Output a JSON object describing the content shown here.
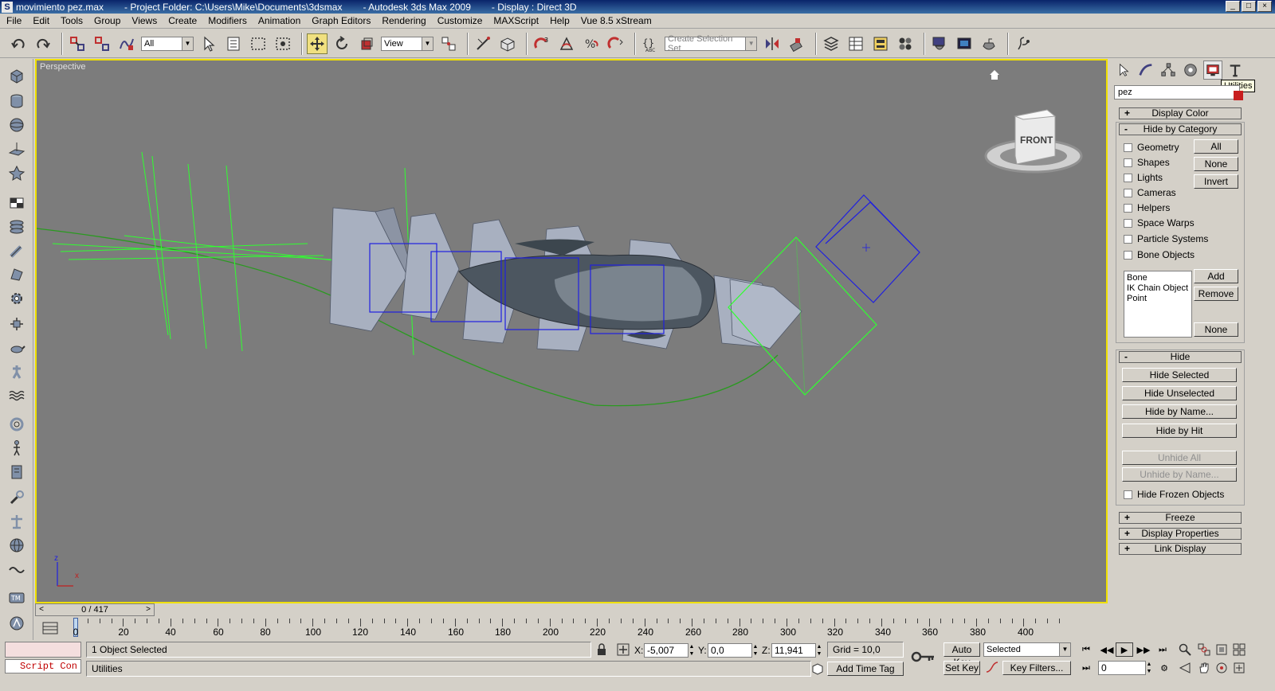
{
  "titlebar": {
    "file": "movimiento pez.max",
    "project": "- Project Folder: C:\\Users\\Mike\\Documents\\3dsmax",
    "app": "- Autodesk 3ds Max  2009",
    "display": "- Display : Direct 3D"
  },
  "menu": [
    "File",
    "Edit",
    "Tools",
    "Group",
    "Views",
    "Create",
    "Modifiers",
    "Animation",
    "Graph Editors",
    "Rendering",
    "Customize",
    "MAXScript",
    "Help",
    "Vue 8.5 xStream"
  ],
  "toolbar": {
    "selection_filter": "All",
    "ref_coord": "View",
    "selection_set_placeholder": "Create Selection Set"
  },
  "viewport": {
    "label": "Perspective",
    "viewcube_label": "FRONT",
    "axis_x": "x",
    "axis_z": "z"
  },
  "panel": {
    "tooltip": "Utilities",
    "name_field": "pez",
    "name_color": "#c81e1e",
    "rollouts": {
      "display_color": "Display Color",
      "hide_by_category": "Hide by Category",
      "hide": "Hide",
      "freeze": "Freeze",
      "display_properties": "Display Properties",
      "link_display": "Link Display"
    },
    "categories": [
      "Geometry",
      "Shapes",
      "Lights",
      "Cameras",
      "Helpers",
      "Space Warps",
      "Particle Systems",
      "Bone Objects"
    ],
    "cat_buttons": [
      "All",
      "None",
      "Invert"
    ],
    "list_items": [
      "Bone",
      "IK Chain Object",
      "Point"
    ],
    "list_buttons": {
      "add": "Add",
      "remove": "Remove",
      "none": "None"
    },
    "hide_buttons": [
      "Hide Selected",
      "Hide Unselected",
      "Hide by Name...",
      "Hide by Hit"
    ],
    "unhide_buttons": [
      "Unhide All",
      "Unhide by Name..."
    ],
    "hide_frozen": "Hide Frozen Objects",
    "plus": "+",
    "minus": "-"
  },
  "timeline": {
    "slider_text": "0 / 417",
    "current_frame": 0,
    "total_frames": 417,
    "ticks": [
      "20",
      "40",
      "60",
      "80",
      "100",
      "120",
      "140",
      "160",
      "180",
      "200",
      "220",
      "240",
      "260",
      "280",
      "300",
      "320",
      "340",
      "360",
      "380",
      "400"
    ]
  },
  "status": {
    "script_label": "Script Con",
    "selection": "1 Object Selected",
    "prompt": "Utilities",
    "x_label": "X:",
    "x_value": "-5,007",
    "y_label": "Y:",
    "y_value": "0,0",
    "z_label": "Z:",
    "z_value": "11,941",
    "grid": "Grid = 10,0",
    "add_time_tag": "Add Time Tag",
    "auto_key": "Auto Key",
    "set_key": "Set Key",
    "key_mode": "Selected",
    "key_filters": "Key Filters...",
    "frame_field": "0"
  }
}
